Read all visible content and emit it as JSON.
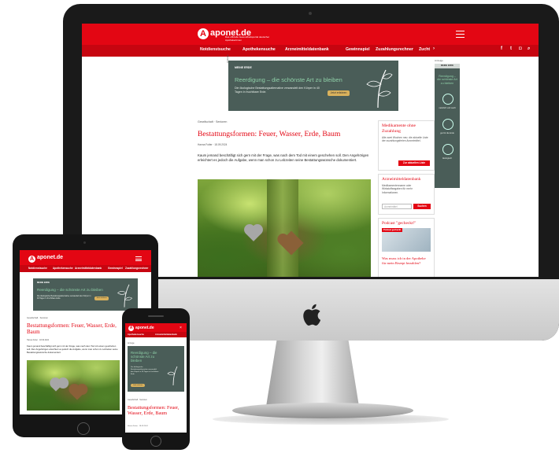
{
  "brand": {
    "name": "aponet.de",
    "tagline": "Das offizielle Gesundheitsportal deutscher Apothekerinnen"
  },
  "nav": {
    "items": [
      "Notdienstsuche",
      "Apothekensuche",
      "Arzneimitteldatenbank",
      "Gewinnspiel",
      "Zuzahlungsrechner",
      "Zucht"
    ]
  },
  "ad": {
    "label": "Anzeige",
    "brand": "MEINE ERDE",
    "title": "Reerdigung – die schönste Art zu bleiben",
    "text": "Die ökologische Bestattungsalternative verwandelt den Körper in 40 Tagen in fruchtbare Erde.",
    "button": "Jetzt erfahren"
  },
  "sidebar_ad": {
    "label": "Anzeige",
    "brand": "MEINE ERDE",
    "title": "Reerdigung – die schönste Art zu bleiben",
    "captions": [
      "natürlich und sanft",
      "gut für die Erde",
      "ökologisch"
    ]
  },
  "article": {
    "breadcrumb": "Gesellschaft · Senioren",
    "title": "Bestattungsformen: Feuer, Wasser, Erde, Baum",
    "meta": "Hanna Futter · 18.09.2024",
    "body": "Kaum jemand beschäftigt sich gern mit der Frage, was nach dem Tod mit einem geschehen soll. Den Angehörigen erleichtert es jedoch die Aufgabe, wenn man schon zu Lebzeiten seine Bestattungswünsche dokumentiert."
  },
  "widgets": {
    "shortage": {
      "title": "Medikamente ohne Zuzahlung",
      "text": "Alle zwei Wochen neu: die aktuelle Liste der zuzahlungsfreien Arzneimittel.",
      "button": "Zur aktuellen Liste"
    },
    "drugdb": {
      "title": "Arzneimitteldatenbank",
      "text": "Medikamentenname oder Wirkstoffangaben für mehr Informationen.",
      "placeholder": "Arzneimittel",
      "button": "Suchen"
    },
    "podcast": {
      "title": "Podcast \"gecheckt!\"",
      "badge": "Podcast gecheckt",
      "teaser": "Was muss ich in der Apotheke für mein Rezept bezahlen?"
    }
  },
  "mobile": {
    "breadcrumb": "Gesellschaft · Senioren",
    "title": "Bestattungsformen: Feuer, Wasser, Erde, Baum",
    "meta": "Hanna Futter · 18.09.2024"
  },
  "colors": {
    "brand_red": "#e30613",
    "ad_dark": "#4a5d58",
    "ad_green": "#8fd0a8"
  }
}
